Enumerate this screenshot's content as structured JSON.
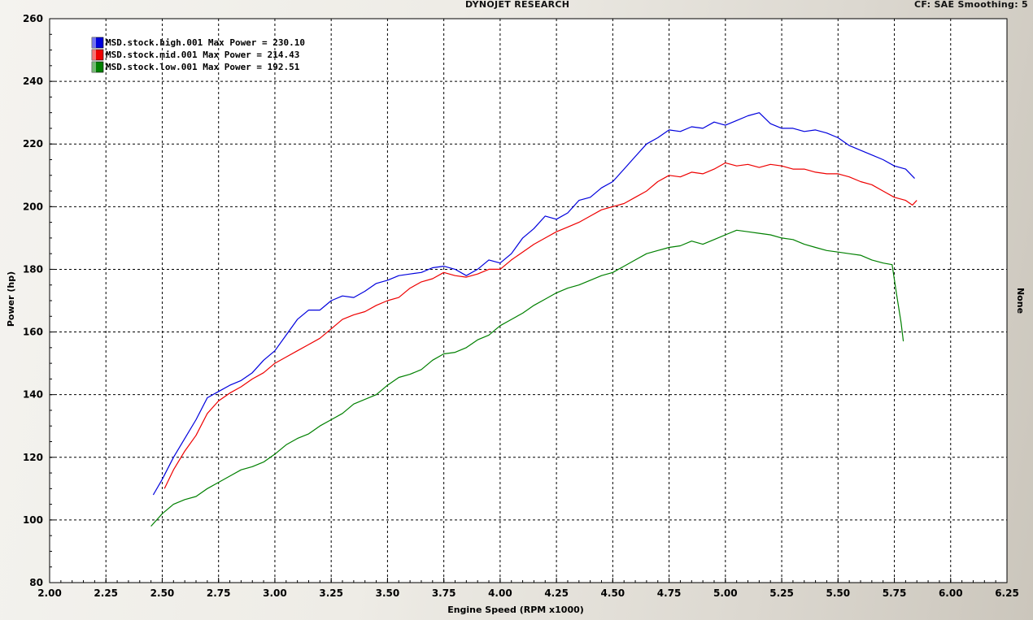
{
  "header": {
    "center_title": "DYNOJET RESEARCH",
    "right_info": "CF: SAE  Smoothing: 5"
  },
  "right_axis_label": "None",
  "chart_data": {
    "type": "line",
    "title": "DYNOJET RESEARCH",
    "xlabel": "Engine Speed (RPM x1000)",
    "ylabel": "Power (hp)",
    "xlim": [
      2.0,
      6.25
    ],
    "ylim": [
      80,
      260
    ],
    "x_ticks": [
      "2.00",
      "2.25",
      "2.50",
      "2.75",
      "3.00",
      "3.25",
      "3.50",
      "3.75",
      "4.00",
      "4.25",
      "4.50",
      "4.75",
      "5.00",
      "5.25",
      "5.50",
      "5.75",
      "6.00",
      "6.25"
    ],
    "y_ticks": [
      "80",
      "100",
      "120",
      "140",
      "160",
      "180",
      "200",
      "220",
      "240",
      "260"
    ],
    "grid": true,
    "legend_position": "top-left",
    "series": [
      {
        "name": "MSD.stock.high.001 Max Power = 230.10",
        "color": "#0000dd",
        "points": [
          [
            2.46,
            108
          ],
          [
            2.5,
            113
          ],
          [
            2.55,
            120
          ],
          [
            2.6,
            126
          ],
          [
            2.65,
            132
          ],
          [
            2.7,
            139
          ],
          [
            2.75,
            141
          ],
          [
            2.8,
            143
          ],
          [
            2.85,
            144.5
          ],
          [
            2.9,
            147
          ],
          [
            2.95,
            151
          ],
          [
            3.0,
            154
          ],
          [
            3.05,
            159
          ],
          [
            3.1,
            164
          ],
          [
            3.15,
            167
          ],
          [
            3.2,
            167
          ],
          [
            3.25,
            170
          ],
          [
            3.3,
            171.5
          ],
          [
            3.35,
            171
          ],
          [
            3.4,
            173
          ],
          [
            3.45,
            175.5
          ],
          [
            3.5,
            176.5
          ],
          [
            3.55,
            178
          ],
          [
            3.6,
            178.5
          ],
          [
            3.65,
            179
          ],
          [
            3.7,
            180.5
          ],
          [
            3.75,
            181
          ],
          [
            3.8,
            180
          ],
          [
            3.85,
            178
          ],
          [
            3.9,
            180
          ],
          [
            3.95,
            183
          ],
          [
            4.0,
            182
          ],
          [
            4.05,
            185
          ],
          [
            4.1,
            190
          ],
          [
            4.15,
            193
          ],
          [
            4.2,
            197
          ],
          [
            4.25,
            196
          ],
          [
            4.3,
            198
          ],
          [
            4.35,
            202
          ],
          [
            4.4,
            203
          ],
          [
            4.45,
            206
          ],
          [
            4.5,
            208
          ],
          [
            4.55,
            212
          ],
          [
            4.6,
            216
          ],
          [
            4.65,
            220
          ],
          [
            4.7,
            222
          ],
          [
            4.75,
            224.5
          ],
          [
            4.8,
            224
          ],
          [
            4.85,
            225.5
          ],
          [
            4.9,
            225
          ],
          [
            4.95,
            227
          ],
          [
            5.0,
            226
          ],
          [
            5.05,
            227.5
          ],
          [
            5.1,
            229
          ],
          [
            5.15,
            230
          ],
          [
            5.2,
            226.5
          ],
          [
            5.25,
            225
          ],
          [
            5.3,
            225
          ],
          [
            5.35,
            224
          ],
          [
            5.4,
            224.5
          ],
          [
            5.45,
            223.5
          ],
          [
            5.5,
            222
          ],
          [
            5.55,
            219.5
          ],
          [
            5.6,
            218
          ],
          [
            5.65,
            216.5
          ],
          [
            5.7,
            215
          ],
          [
            5.75,
            213
          ],
          [
            5.8,
            212
          ],
          [
            5.84,
            209
          ]
        ]
      },
      {
        "name": "MSD.stock.mid.001 Max Power = 214.43",
        "color": "#ee0000",
        "points": [
          [
            2.51,
            110
          ],
          [
            2.55,
            116
          ],
          [
            2.6,
            122
          ],
          [
            2.65,
            127
          ],
          [
            2.7,
            134
          ],
          [
            2.75,
            138
          ],
          [
            2.8,
            140.5
          ],
          [
            2.85,
            142.5
          ],
          [
            2.9,
            145
          ],
          [
            2.95,
            147
          ],
          [
            3.0,
            150
          ],
          [
            3.05,
            152
          ],
          [
            3.1,
            154
          ],
          [
            3.15,
            156
          ],
          [
            3.2,
            158
          ],
          [
            3.25,
            161
          ],
          [
            3.3,
            164
          ],
          [
            3.35,
            165.5
          ],
          [
            3.4,
            166.5
          ],
          [
            3.45,
            168.5
          ],
          [
            3.5,
            170
          ],
          [
            3.55,
            171
          ],
          [
            3.6,
            174
          ],
          [
            3.65,
            176
          ],
          [
            3.7,
            177
          ],
          [
            3.75,
            179
          ],
          [
            3.8,
            178
          ],
          [
            3.85,
            177.5
          ],
          [
            3.9,
            178.5
          ],
          [
            3.95,
            180
          ],
          [
            4.0,
            180
          ],
          [
            4.05,
            183
          ],
          [
            4.1,
            185.5
          ],
          [
            4.15,
            188
          ],
          [
            4.2,
            190
          ],
          [
            4.25,
            192
          ],
          [
            4.3,
            193.5
          ],
          [
            4.35,
            195
          ],
          [
            4.4,
            197
          ],
          [
            4.45,
            199
          ],
          [
            4.5,
            200
          ],
          [
            4.55,
            201
          ],
          [
            4.6,
            203
          ],
          [
            4.65,
            205
          ],
          [
            4.7,
            208
          ],
          [
            4.75,
            210
          ],
          [
            4.8,
            209.5
          ],
          [
            4.85,
            211
          ],
          [
            4.9,
            210.5
          ],
          [
            4.95,
            212
          ],
          [
            5.0,
            214
          ],
          [
            5.05,
            213
          ],
          [
            5.1,
            213.5
          ],
          [
            5.15,
            212.5
          ],
          [
            5.2,
            213.5
          ],
          [
            5.25,
            213
          ],
          [
            5.3,
            212
          ],
          [
            5.35,
            212
          ],
          [
            5.4,
            211
          ],
          [
            5.45,
            210.5
          ],
          [
            5.5,
            210.5
          ],
          [
            5.55,
            209.5
          ],
          [
            5.6,
            208
          ],
          [
            5.65,
            207
          ],
          [
            5.7,
            205
          ],
          [
            5.75,
            203
          ],
          [
            5.8,
            202
          ],
          [
            5.83,
            200.5
          ],
          [
            5.85,
            202
          ]
        ]
      },
      {
        "name": "MSD.stock.low.001 Max Power = 192.51",
        "color": "#008000",
        "points": [
          [
            2.45,
            98
          ],
          [
            2.5,
            102
          ],
          [
            2.55,
            105
          ],
          [
            2.6,
            106.5
          ],
          [
            2.65,
            107.5
          ],
          [
            2.7,
            110
          ],
          [
            2.75,
            112
          ],
          [
            2.8,
            114
          ],
          [
            2.85,
            116
          ],
          [
            2.9,
            117
          ],
          [
            2.95,
            118.5
          ],
          [
            3.0,
            121
          ],
          [
            3.05,
            124
          ],
          [
            3.1,
            126
          ],
          [
            3.15,
            127.5
          ],
          [
            3.2,
            130
          ],
          [
            3.25,
            132
          ],
          [
            3.3,
            134
          ],
          [
            3.35,
            137
          ],
          [
            3.4,
            138.5
          ],
          [
            3.45,
            140
          ],
          [
            3.5,
            143
          ],
          [
            3.55,
            145.5
          ],
          [
            3.6,
            146.5
          ],
          [
            3.65,
            148
          ],
          [
            3.7,
            151
          ],
          [
            3.75,
            153
          ],
          [
            3.8,
            153.5
          ],
          [
            3.85,
            155
          ],
          [
            3.9,
            157.5
          ],
          [
            3.95,
            159
          ],
          [
            4.0,
            162
          ],
          [
            4.05,
            164
          ],
          [
            4.1,
            166
          ],
          [
            4.15,
            168.5
          ],
          [
            4.2,
            170.5
          ],
          [
            4.25,
            172.5
          ],
          [
            4.3,
            174
          ],
          [
            4.35,
            175
          ],
          [
            4.4,
            176.5
          ],
          [
            4.45,
            178
          ],
          [
            4.5,
            179
          ],
          [
            4.55,
            181
          ],
          [
            4.6,
            183
          ],
          [
            4.65,
            185
          ],
          [
            4.7,
            186
          ],
          [
            4.75,
            187
          ],
          [
            4.8,
            187.5
          ],
          [
            4.85,
            189
          ],
          [
            4.9,
            188
          ],
          [
            4.95,
            189.5
          ],
          [
            5.0,
            191
          ],
          [
            5.05,
            192.5
          ],
          [
            5.1,
            192
          ],
          [
            5.15,
            191.5
          ],
          [
            5.2,
            191
          ],
          [
            5.25,
            190
          ],
          [
            5.3,
            189.5
          ],
          [
            5.35,
            188
          ],
          [
            5.4,
            187
          ],
          [
            5.45,
            186
          ],
          [
            5.5,
            185.5
          ],
          [
            5.55,
            185
          ],
          [
            5.6,
            184.5
          ],
          [
            5.65,
            183
          ],
          [
            5.7,
            182
          ],
          [
            5.74,
            181.5
          ],
          [
            5.76,
            172
          ],
          [
            5.78,
            163
          ],
          [
            5.79,
            157
          ]
        ]
      }
    ]
  }
}
